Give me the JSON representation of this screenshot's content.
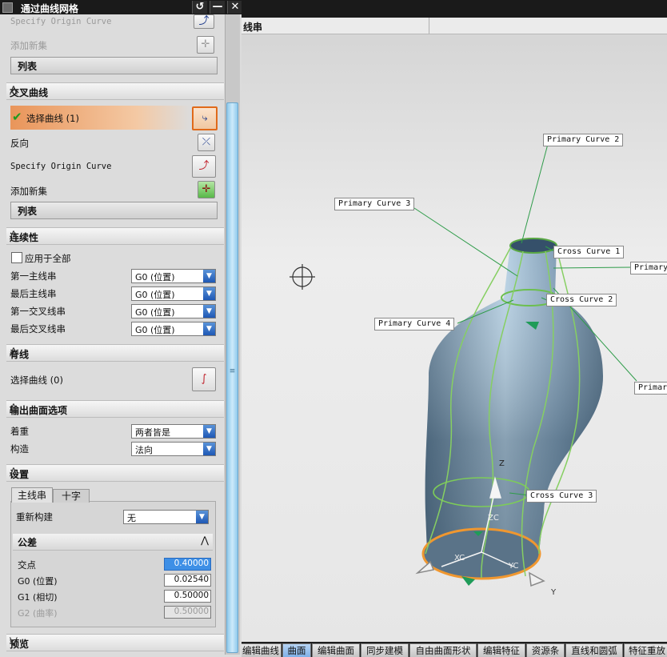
{
  "dialog": {
    "title": "通过曲线网格",
    "top": {
      "specify_origin": "Specify Origin Curve",
      "add_new_set": "添加新集",
      "list": "列表"
    },
    "cross_curves": {
      "header": "交叉曲线",
      "select_curve": "选择曲线 (1)",
      "reverse": "反向",
      "specify_origin": "Specify Origin Curve",
      "add_new_set": "添加新集",
      "list": "列表"
    },
    "continuity": {
      "header": "连续性",
      "apply_all": "应用于全部",
      "rows": [
        {
          "label": "第一主线串",
          "value": "G0 (位置)"
        },
        {
          "label": "最后主线串",
          "value": "G0 (位置)"
        },
        {
          "label": "第一交叉线串",
          "value": "G0 (位置)"
        },
        {
          "label": "最后交叉线串",
          "value": "G0 (位置)"
        }
      ]
    },
    "spine": {
      "header": "脊线",
      "select_curve": "选择曲线 (0)"
    },
    "output": {
      "header": "输出曲面选项",
      "emphasis_label": "着重",
      "emphasis_value": "两者皆是",
      "construct_label": "构造",
      "construct_value": "法向"
    },
    "settings": {
      "header": "设置",
      "tabs": [
        "主线串",
        "十字"
      ],
      "rebuild_label": "重新构建",
      "rebuild_value": "无",
      "tolerance_header": "公差",
      "tolerances": [
        {
          "label": "交点",
          "value": "0.40000"
        },
        {
          "label": "G0 (位置)",
          "value": "0.02540"
        },
        {
          "label": "G1 (相切)",
          "value": "0.50000"
        },
        {
          "label": "G2 (曲率)",
          "value": "0.50000"
        }
      ]
    },
    "preview": {
      "header": "预览"
    }
  },
  "graphics": {
    "strip_label": "线串",
    "callouts": {
      "primary_2": "Primary Curve  2",
      "primary_3": "Primary Curve  3",
      "primary_4": "Primary Curve  4",
      "primary_1": "Primary",
      "primary_5": "Primar",
      "cross_1": "Cross Curve  1",
      "cross_2": "Cross Curve  2",
      "cross_3": "Cross Curve  3"
    },
    "axes": {
      "z": "Z",
      "zc": "ZC",
      "xc": "XC",
      "yc": "YC",
      "y": "Y"
    }
  },
  "bottom_tabs": [
    "编辑曲线",
    "曲面",
    "编辑曲面",
    "同步建模",
    "自由曲面形状",
    "编辑特征",
    "资源条",
    "直线和圆弧",
    "特征重放"
  ],
  "colors": {
    "accent": "#f0b27a",
    "selection_border": "#e06a1a",
    "check": "#22a22a",
    "scroll": "#8fc9ec",
    "tab_active": "#7fb0e8"
  }
}
